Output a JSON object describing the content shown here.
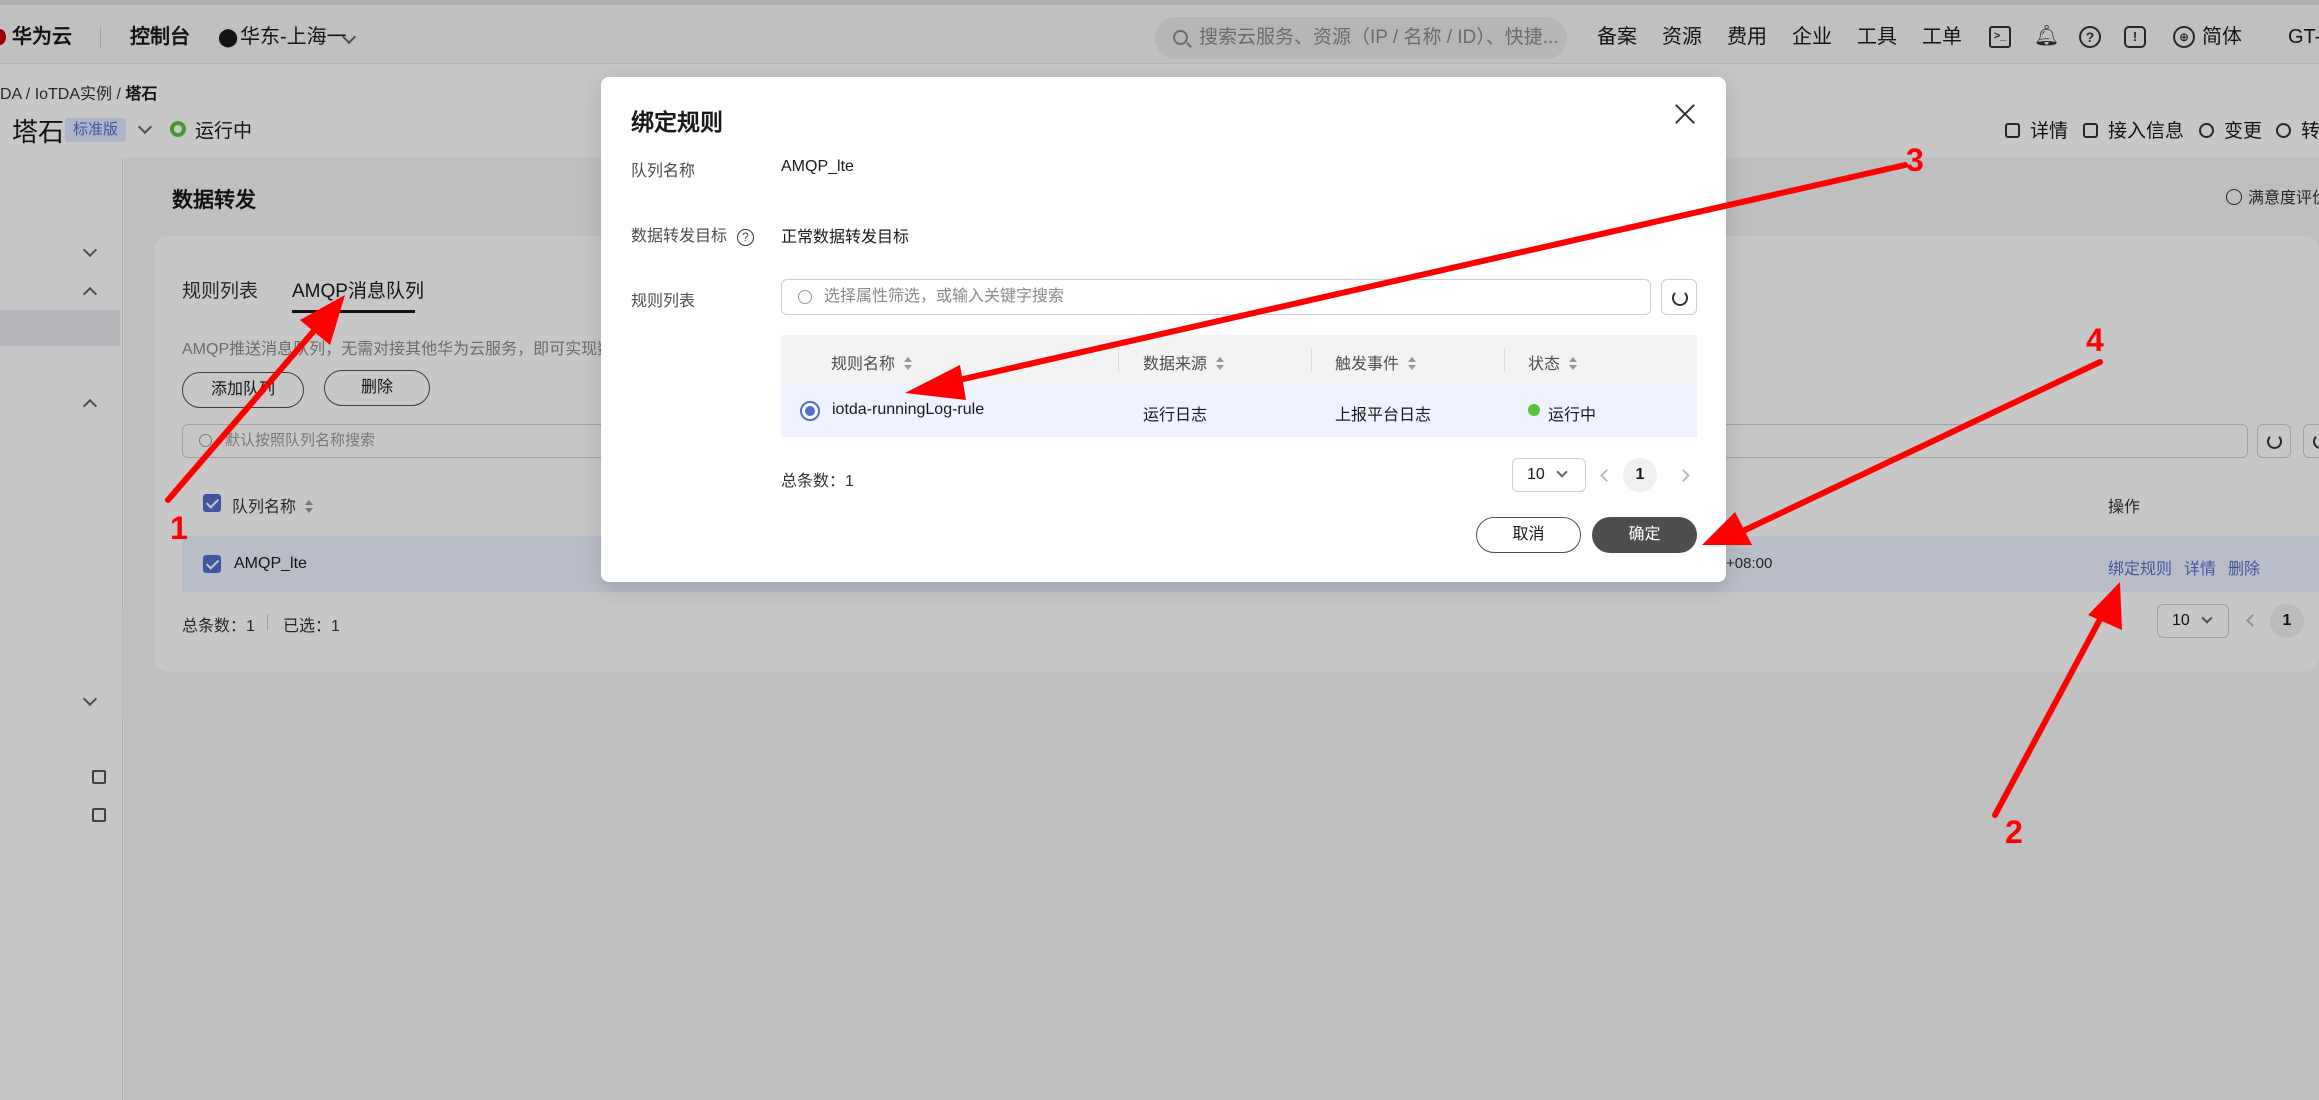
{
  "topnav": {
    "brand": "华为云",
    "console": "控制台",
    "region": "华东-上海一",
    "search_placeholder": "搜索云服务、资源（IP / 名称 / ID）、快捷...",
    "links": [
      "备案",
      "资源",
      "费用",
      "企业",
      "工具",
      "工单"
    ],
    "lang": "简体",
    "account": "GT-"
  },
  "breadcrumb": {
    "items": [
      "DA",
      "IoTDA实例"
    ],
    "current": "塔石"
  },
  "instance": {
    "name": "塔石",
    "edition": "标准版",
    "status": "运行中",
    "actions": [
      "详情",
      "接入信息",
      "变更",
      "转"
    ]
  },
  "page": {
    "section_title": "数据转发",
    "satisfaction": "满意度评价",
    "tabs": [
      "规则列表",
      "AMQP消息队列"
    ],
    "description": "AMQP推送消息队列，无需对接其他华为云服务，即可实现数据",
    "add_button": "添加队列",
    "delete_button": "删除",
    "filter_placeholder": "默认按照队列名称搜索",
    "table": {
      "header_name": "队列名称",
      "header_ops": "操作",
      "row_name": "AMQP_lte",
      "row_time_tail": "+08:00",
      "ops": [
        "绑定规则",
        "详情",
        "删除"
      ]
    },
    "footer": {
      "total": "总条数：1",
      "selected": "已选：1",
      "page_size": "10",
      "page": "1"
    }
  },
  "modal": {
    "title": "绑定规则",
    "queue_label": "队列名称",
    "queue_value": "AMQP_lte",
    "target_label": "数据转发目标",
    "target_value": "正常数据转发目标",
    "rules_label": "规则列表",
    "search_placeholder": "选择属性筛选，或输入关键字搜索",
    "columns": [
      "规则名称",
      "数据来源",
      "触发事件",
      "状态"
    ],
    "row": {
      "name": "iotda-runningLog-rule",
      "source": "运行日志",
      "event": "上报平台日志",
      "status": "运行中"
    },
    "total": "总条数：1",
    "page_size": "10",
    "page": "1",
    "cancel": "取消",
    "confirm": "确定"
  },
  "annotations": {
    "numbers": [
      "1",
      "2",
      "3",
      "4"
    ],
    "color": "#ff0000"
  }
}
